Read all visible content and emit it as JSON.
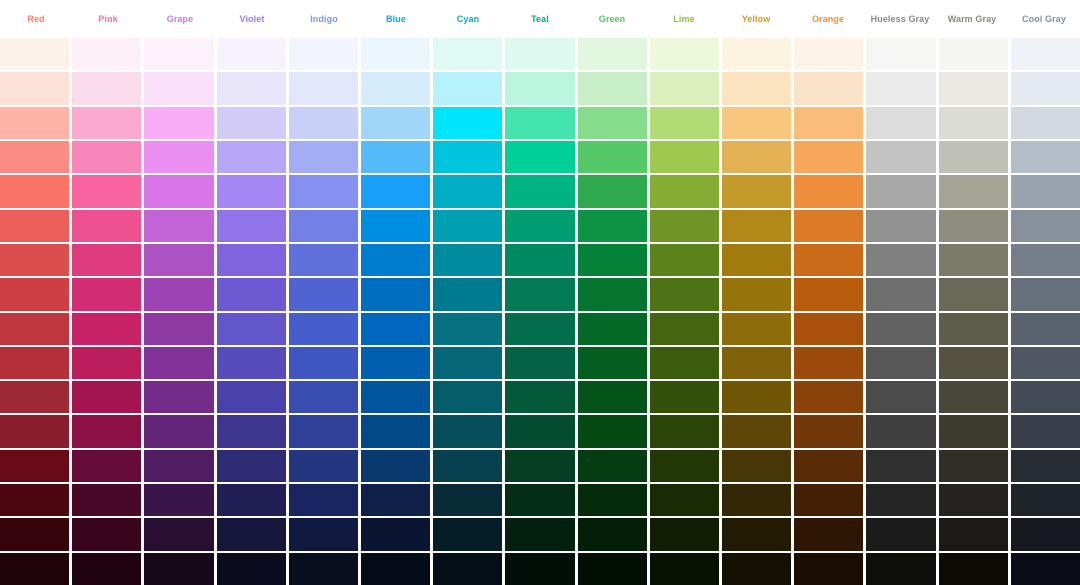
{
  "page": {
    "background_color": "#ffffff",
    "gridline_color": "#ffffff"
  },
  "palette": {
    "row_count": 16,
    "columns": [
      {
        "label": "Red",
        "label_color": "#f87e6d",
        "shades": [
          "#fdf2e9",
          "#fce2d6",
          "#fdb4a8",
          "#fc8b83",
          "#fa7369",
          "#eb5e5a",
          "#dc4e4e",
          "#cf3d45",
          "#c0363f",
          "#b52f3a",
          "#9e2833",
          "#8a1d2b",
          "#690a17",
          "#4b060f",
          "#38040c",
          "#1e0309"
        ]
      },
      {
        "label": "Pink",
        "label_color": "#f871a8",
        "shades": [
          "#fdf0f6",
          "#fbdcec",
          "#fba9ce",
          "#f986ba",
          "#f8659e",
          "#ee518f",
          "#df3c7f",
          "#d22d73",
          "#c82366",
          "#bc1d5b",
          "#a2154e",
          "#8d1045",
          "#670c38",
          "#4a0827",
          "#38051c",
          "#1f0310"
        ]
      },
      {
        "label": "Grape",
        "label_color": "#c97ce4",
        "shades": [
          "#fcf2fc",
          "#fbe0fb",
          "#f9adf7",
          "#ea8ff1",
          "#d976e7",
          "#c364d7",
          "#ac53c3",
          "#9c44b3",
          "#8c3aa2",
          "#813399",
          "#732c8a",
          "#632578",
          "#501d63",
          "#3a154a",
          "#2a0e32",
          "#170919"
        ]
      },
      {
        "label": "Violet",
        "label_color": "#9480f5",
        "shades": [
          "#f6f3fd",
          "#e9e6fb",
          "#d4ccf8",
          "#b7a5f5",
          "#a487f3",
          "#9174e9",
          "#7e64dd",
          "#6d59d1",
          "#6356ca",
          "#584cbc",
          "#4b41aa",
          "#3e358e",
          "#2f2a74",
          "#221f56",
          "#16153a",
          "#0b0a1f"
        ]
      },
      {
        "label": "Indigo",
        "label_color": "#8093f6",
        "shades": [
          "#f3f5fe",
          "#e2e8fc",
          "#c8d0f8",
          "#a2adf4",
          "#8591f0",
          "#7381e7",
          "#6070dc",
          "#4f63d2",
          "#465ecd",
          "#3f55c2",
          "#394db1",
          "#31419a",
          "#253680",
          "#192560",
          "#101a40",
          "#080d20"
        ]
      },
      {
        "label": "Blue",
        "label_color": "#19a0f4",
        "shades": [
          "#ecf6fd",
          "#d4ecfc",
          "#a0d6fa",
          "#55bbf8",
          "#18a0f8",
          "#008ee0",
          "#007dce",
          "#006ec0",
          "#0067be",
          "#005fb0",
          "#00569c",
          "#004a88",
          "#093a6e",
          "#0f2149",
          "#091530",
          "#040b19"
        ]
      },
      {
        "label": "Cyan",
        "label_color": "#00b3cb",
        "shades": [
          "#dff9f4",
          "#b5f2fc",
          "#00e5fa",
          "#00c4de",
          "#00aec6",
          "#009fb2",
          "#008b9e",
          "#007a8e",
          "#067180",
          "#056778",
          "#055c6b",
          "#064e5c",
          "#07404f",
          "#082b37",
          "#051d26",
          "#030f14"
        ]
      },
      {
        "label": "Teal",
        "label_color": "#00b081",
        "shades": [
          "#defaf0",
          "#baf6df",
          "#43e4ae",
          "#00cf97",
          "#00b480",
          "#009e71",
          "#008a62",
          "#027a55",
          "#046e4c",
          "#036344",
          "#03593a",
          "#044c31",
          "#053f23",
          "#042d18",
          "#031f10",
          "#020f08"
        ]
      },
      {
        "label": "Green",
        "label_color": "#58c163",
        "shades": [
          "#e1f8de",
          "#c7eec6",
          "#85dc8a",
          "#55c968",
          "#2fa84e",
          "#0d9545",
          "#048338",
          "#05742f",
          "#046827",
          "#045e20",
          "#035318",
          "#044812",
          "#053c10",
          "#042b0a",
          "#031e06",
          "#020f04"
        ]
      },
      {
        "label": "Lime",
        "label_color": "#8cc23c",
        "shades": [
          "#eef8da",
          "#dcf0be",
          "#afdc74",
          "#9cc94e",
          "#86ad33",
          "#6e9525",
          "#5c831b",
          "#4d7314",
          "#446610",
          "#3c5c0d",
          "#34510b",
          "#2b4509",
          "#223807",
          "#192b05",
          "#111e04",
          "#091202"
        ]
      },
      {
        "label": "Yellow",
        "label_color": "#cb9d28",
        "shades": [
          "#fdf3e1",
          "#fce4c1",
          "#f8c67c",
          "#e3b254",
          "#c49a2a",
          "#b28818",
          "#a17b0e",
          "#97730c",
          "#8c6c0b",
          "#7f6209",
          "#705607",
          "#5d4608",
          "#483607",
          "#342706",
          "#231a04",
          "#141002"
        ]
      },
      {
        "label": "Orange",
        "label_color": "#f0913f",
        "shades": [
          "#fdf3e7",
          "#fbe3c9",
          "#f9bd79",
          "#f7a85c",
          "#ee8d3b",
          "#dd7a28",
          "#cb6b1a",
          "#b85c0e",
          "#a8520d",
          "#9c4b0c",
          "#8a420b",
          "#723709",
          "#5a2b07",
          "#421f05",
          "#2f1604",
          "#1b0d02"
        ]
      },
      {
        "label": "Hueless Gray",
        "label_color": "#8a8a8a",
        "shades": [
          "#f6f6f5",
          "#ebebeb",
          "#dcdcdc",
          "#c3c3c3",
          "#a8a8a8",
          "#929292",
          "#808080",
          "#6f6f6f",
          "#626262",
          "#575757",
          "#4b4b4b",
          "#3f3f3f",
          "#303030",
          "#252525",
          "#1b1b1b",
          "#0e0e0b"
        ]
      },
      {
        "label": "Warm Gray",
        "label_color": "#8b887d",
        "shades": [
          "#f5f5f1",
          "#e9e8e3",
          "#dadbd2",
          "#bfc0b6",
          "#a5a596",
          "#8f8e7e",
          "#7c7a68",
          "#6b6957",
          "#5e5c4b",
          "#54523f",
          "#494737",
          "#3d3b2d",
          "#302e27",
          "#242320",
          "#1b1a16",
          "#0c0b06"
        ]
      },
      {
        "label": "Cool Gray",
        "label_color": "#87909b",
        "shades": [
          "#eff3f7",
          "#e3eaf0",
          "#d2d9e1",
          "#b3bec9",
          "#99a4b0",
          "#86919d",
          "#757f8c",
          "#65707c",
          "#59626f",
          "#4e5763",
          "#434b57",
          "#383f4a",
          "#282d34",
          "#1f242b",
          "#161a20",
          "#0a0d18"
        ]
      }
    ]
  }
}
